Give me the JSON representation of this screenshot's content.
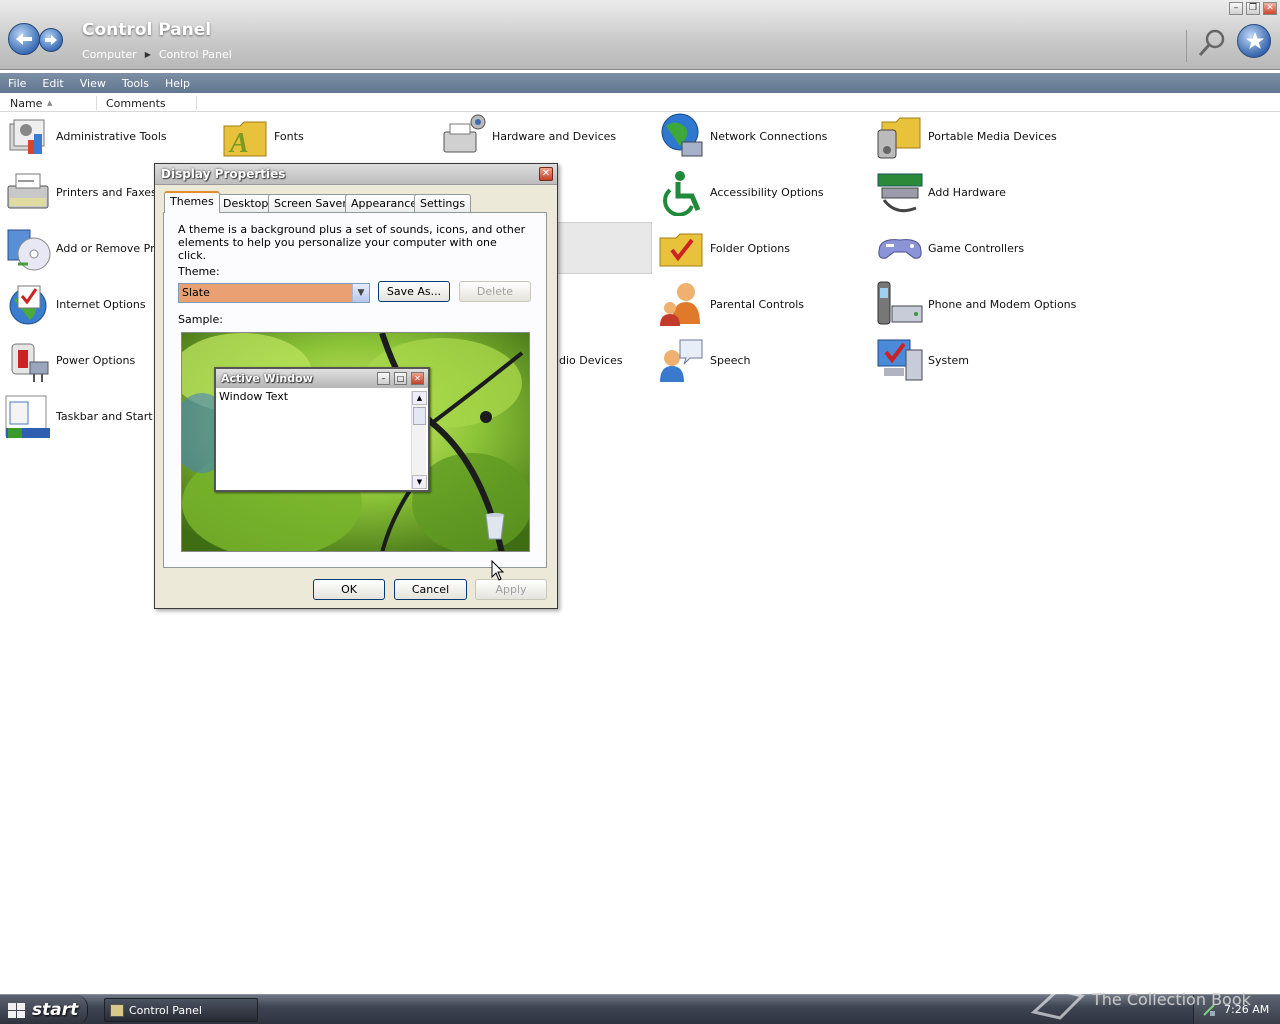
{
  "window": {
    "title": "Control Panel",
    "breadcrumb": [
      "Computer",
      "Control Panel"
    ]
  },
  "menu": [
    "File",
    "Edit",
    "View",
    "Tools",
    "Help"
  ],
  "columns": {
    "name": "Name",
    "comments": "Comments"
  },
  "items": [
    {
      "label": "Administrative Tools",
      "icon": "admin-tools-icon"
    },
    {
      "label": "Printers and Faxes",
      "icon": "printer-icon"
    },
    {
      "label": "Add or Remove Prog",
      "icon": "add-remove-programs-icon"
    },
    {
      "label": "Internet Options",
      "icon": "internet-options-icon"
    },
    {
      "label": "Power Options",
      "icon": "power-options-icon"
    },
    {
      "label": "Taskbar and Start M",
      "icon": "taskbar-start-icon"
    },
    {
      "label": "Fonts",
      "icon": "fonts-folder-icon"
    },
    {
      "label": "Hardware and Devices",
      "icon": "hardware-devices-icon"
    },
    {
      "label": "udio Devices",
      "icon": "audio-devices-icon"
    },
    {
      "label": "Network Connections",
      "icon": "network-connections-icon"
    },
    {
      "label": "Accessibility Options",
      "icon": "accessibility-icon"
    },
    {
      "label": "Folder Options",
      "icon": "folder-options-icon"
    },
    {
      "label": "Parental Controls",
      "icon": "parental-controls-icon"
    },
    {
      "label": "Speech",
      "icon": "speech-icon"
    },
    {
      "label": "Portable Media Devices",
      "icon": "portable-media-icon"
    },
    {
      "label": "Add Hardware",
      "icon": "add-hardware-icon"
    },
    {
      "label": "Game Controllers",
      "icon": "game-controller-icon"
    },
    {
      "label": "Phone and Modem Options",
      "icon": "phone-modem-icon"
    },
    {
      "label": "System",
      "icon": "system-icon"
    }
  ],
  "dialog": {
    "title": "Display Properties",
    "tabs": [
      "Themes",
      "Desktop",
      "Screen Saver",
      "Appearance",
      "Settings"
    ],
    "active_tab": "Themes",
    "description": "A theme is a background plus a set of sounds, icons, and other elements to help you personalize your computer with one click.",
    "theme_label": "Theme:",
    "theme_value": "Slate",
    "save_as": "Save As...",
    "delete": "Delete",
    "sample_label": "Sample:",
    "preview": {
      "window_title": "Active Window",
      "window_text": "Window Text"
    },
    "ok": "OK",
    "cancel": "Cancel",
    "apply": "Apply"
  },
  "taskbar": {
    "start": "start",
    "task_label": "Control Panel",
    "clock": "7:26 AM",
    "watermark": "The Collection Book"
  },
  "colors": {
    "menubar": "#6a7e97",
    "theme_select_bg": "#e9a174",
    "tab_highlight": "#e68b2c"
  }
}
